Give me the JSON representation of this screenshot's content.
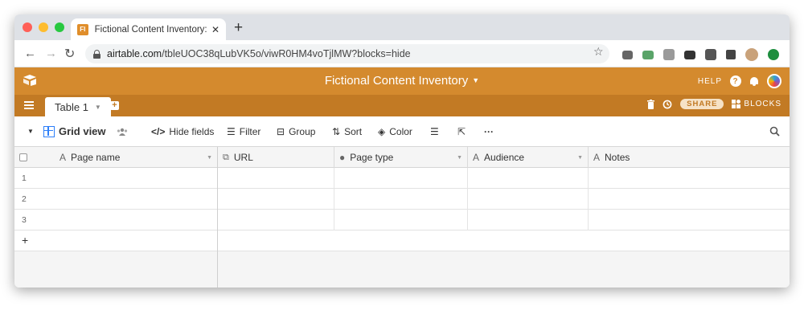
{
  "browser": {
    "tab_title": "Fictional Content Inventory: Tab",
    "favicon_text": "FI",
    "url_host": "airtable.com",
    "url_path": "/tbleUOC38qLubVK5o/viwR0HM4voTjlMW?blocks=hide",
    "traffic_lights": [
      "#ff5f57",
      "#febc2e",
      "#28c840"
    ],
    "extensions": [
      "camera-icon",
      "mail-icon",
      "shield-icon",
      "more-icon",
      "facebook-icon",
      "puzzle-icon",
      "profile-avatar",
      "update-icon"
    ]
  },
  "airtable": {
    "base_title": "Fictional Content Inventory",
    "header_right": {
      "help": "HELP",
      "help_icon": "?"
    },
    "accent": "#d48a2e",
    "table_tab": "Table 1",
    "share": "SHARE",
    "blocks": "BLOCKS"
  },
  "viewbar": {
    "view_name": "Grid view",
    "hide_fields": "Hide fields",
    "filter": "Filter",
    "group": "Group",
    "sort": "Sort",
    "color": "Color",
    "more": "···"
  },
  "grid": {
    "columns": [
      {
        "name": "Page name",
        "icon": "A"
      },
      {
        "name": "URL",
        "icon": "✉"
      },
      {
        "name": "Page type",
        "icon": "●"
      },
      {
        "name": "Audience",
        "icon": "A"
      },
      {
        "name": "Notes",
        "icon": "A"
      }
    ],
    "rows": [
      "1",
      "2",
      "3"
    ],
    "add_row": "+"
  }
}
